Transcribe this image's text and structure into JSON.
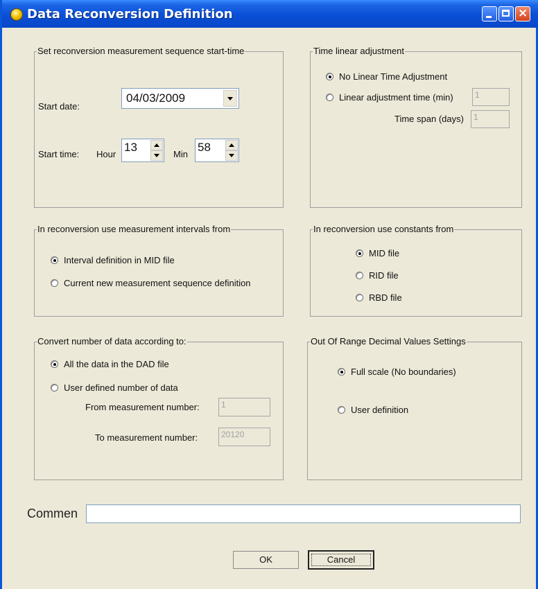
{
  "window": {
    "title": "Data Reconversion Definition"
  },
  "start_time_group": {
    "title": "Set reconversion  measurement sequence start-time",
    "start_date_label": "Start date:",
    "start_date_value": "04/03/2009",
    "start_time_label": "Start time:",
    "hour_label": "Hour",
    "hour_value": "13",
    "min_label": "Min",
    "min_value": "58"
  },
  "time_linear_group": {
    "title": "Time linear adjustment",
    "options": [
      {
        "label": "No Linear Time Adjustment",
        "checked": true
      },
      {
        "label": "Linear adjustment time (min)",
        "checked": false
      }
    ],
    "adjustment_time_value": "1",
    "time_span_label": "Time span (days)",
    "time_span_value": "1"
  },
  "intervals_group": {
    "title": "In reconversion use measurement intervals from",
    "options": [
      {
        "label": "Interval definition in MID file",
        "checked": true
      },
      {
        "label": "Current new measurement sequence definition",
        "checked": false
      }
    ]
  },
  "constants_group": {
    "title": "In reconversion use constants from",
    "options": [
      {
        "label": "MID file",
        "checked": true
      },
      {
        "label": "RID file",
        "checked": false
      },
      {
        "label": "RBD file",
        "checked": false
      }
    ]
  },
  "convert_group": {
    "title": "Convert number of data according to:",
    "options": [
      {
        "label": "All the data in the DAD file",
        "checked": true
      },
      {
        "label": "User defined number of data",
        "checked": false
      }
    ],
    "from_label": "From measurement number:",
    "from_value": "1",
    "to_label": "To measurement number:",
    "to_value": "20120"
  },
  "range_group": {
    "title": "Out Of Range Decimal Values Settings",
    "options": [
      {
        "label": "Full scale (No boundaries)",
        "checked": true
      },
      {
        "label": "User definition",
        "checked": false
      }
    ]
  },
  "comment": {
    "label": "Commen",
    "value": ""
  },
  "buttons": {
    "ok": "OK",
    "cancel": "Cancel"
  },
  "colors": {
    "titlebar": "#0A4FD6",
    "dialog_bg": "#ECE9D8",
    "field_border": "#7f9db9"
  }
}
